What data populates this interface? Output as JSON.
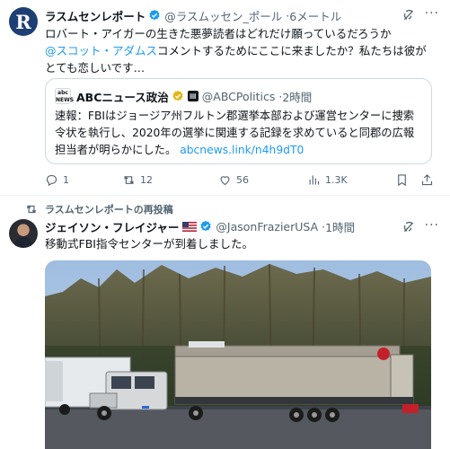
{
  "tweet1": {
    "avatar_letter": "R",
    "name": "ラスムセンレポート",
    "handle": "@ラスムッセン_ポール",
    "time": "6メートル",
    "text_line1": "ロバート・アイガーの生きた悪夢読者はどれだけ願っているだろうか",
    "mention": "@スコット・アダムス",
    "text_line2_rest": "コメントするためにここに来ましたか？私たちは彼が",
    "text_line3": "とても恋しいです…",
    "quote": {
      "avatar_text": "abc NEWS",
      "name": "ABCニュース政治",
      "handle": "@ABCPolitics",
      "time": "2時間",
      "text": "速報：FBIはジョージア州フルトン郡選挙本部および運営センターに捜索令状を執行し、2020年の選挙に関連する記録を求めていると同郡の広報担当者が明らかにした。",
      "link": "abcnews.link/n4h9dT0"
    },
    "stats": {
      "replies": "1",
      "reposts": "12",
      "likes": "56",
      "views": "1.3K"
    }
  },
  "repost_label": "ラスムセンレポートの再投稿",
  "tweet2": {
    "name": "ジェイソン・フレイジャー",
    "handle": "@JasonFrazierUSA",
    "time": "1時間",
    "text": "移動式FBI指令センターが到着しました。"
  },
  "colors": {
    "accent": "#1d9bf0",
    "verified_gold": "#e2b719",
    "secondary_text": "#536471"
  }
}
